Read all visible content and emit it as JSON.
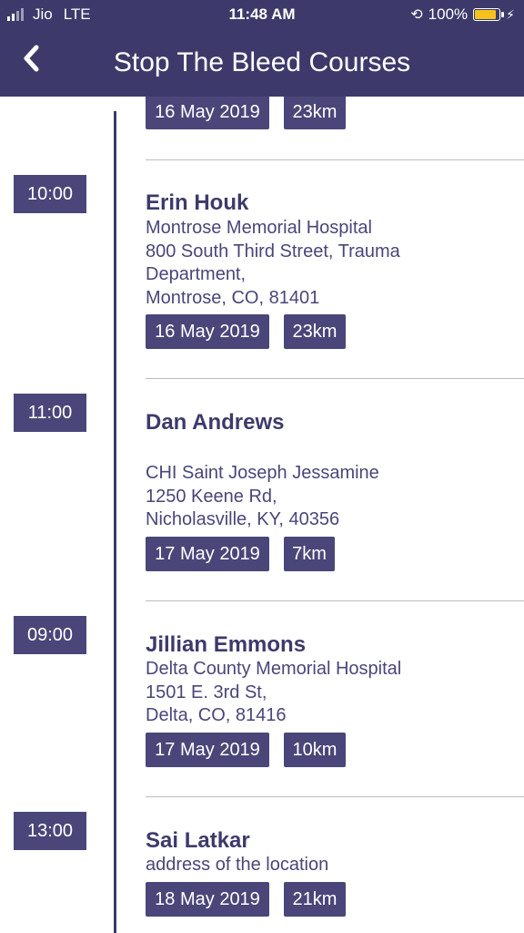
{
  "status_bar": {
    "carrier": "Jio",
    "network": "LTE",
    "time": "11:48 AM",
    "battery": "100%",
    "battery_color": "#f4c21b"
  },
  "header": {
    "title": "Stop The Bleed Courses",
    "back_icon": "chevron-left-icon",
    "background": "#3d3a6b"
  },
  "top_partial": {
    "date": "16 May 2019",
    "distance": "23km"
  },
  "courses": [
    {
      "time": "10:00",
      "name": "Erin Houk",
      "address": "Montrose Memorial Hospital\n800 South Third Street, Trauma\nDepartment,\nMontrose, CO, 81401",
      "date": "16 May 2019",
      "distance": "23km"
    },
    {
      "time": "11:00",
      "name": "Dan Andrews",
      "address": "CHI Saint Joseph Jessamine\n1250 Keene Rd,\nNicholasville, KY, 40356",
      "date": "17 May 2019",
      "distance": "7km"
    },
    {
      "time": "09:00",
      "name": "Jillian Emmons",
      "address": "Delta County Memorial Hospital\n1501 E. 3rd St,\nDelta, CO, 81416",
      "date": "17 May 2019",
      "distance": "10km"
    },
    {
      "time": "13:00",
      "name": "Sai Latkar",
      "address": "address of the location",
      "date": "18 May 2019",
      "distance": "21km"
    }
  ]
}
